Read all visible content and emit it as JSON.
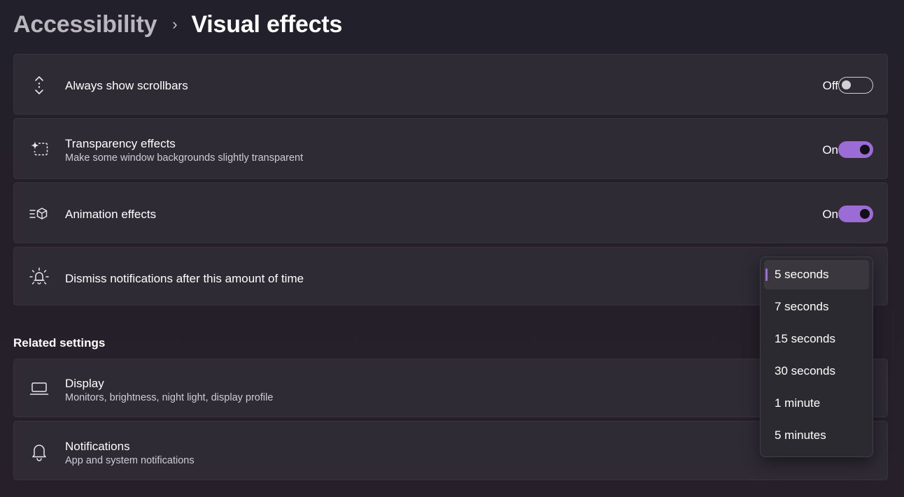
{
  "breadcrumb": {
    "parent": "Accessibility",
    "separator": "›",
    "current": "Visual effects"
  },
  "settings": [
    {
      "title": "Always show scrollbars",
      "icon": "scrollbar-icon",
      "toggle_state": "Off",
      "toggle_on": false
    },
    {
      "title": "Transparency effects",
      "subtitle": "Make some window backgrounds slightly transparent",
      "icon": "transparency-icon",
      "toggle_state": "On",
      "toggle_on": true
    },
    {
      "title": "Animation effects",
      "icon": "animation-icon",
      "toggle_state": "On",
      "toggle_on": true
    },
    {
      "title": "Dismiss notifications after this amount of time",
      "icon": "notification-timeout-icon"
    }
  ],
  "related": {
    "heading": "Related settings",
    "items": [
      {
        "title": "Display",
        "subtitle": "Monitors, brightness, night light, display profile",
        "icon": "laptop-icon"
      },
      {
        "title": "Notifications",
        "subtitle": "App and system notifications",
        "icon": "bell-icon"
      }
    ]
  },
  "dropdown": {
    "selected": "5 seconds",
    "options": [
      "5 seconds",
      "7 seconds",
      "15 seconds",
      "30 seconds",
      "1 minute",
      "5 minutes"
    ]
  },
  "colors": {
    "accent": "#9b6bd6",
    "card": "#2e2b35",
    "background": "#22202a"
  }
}
